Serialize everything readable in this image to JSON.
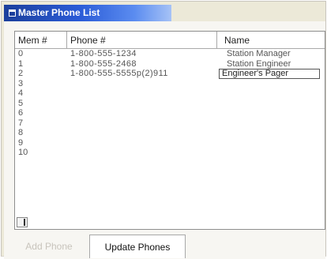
{
  "window": {
    "title": "Master Phone List"
  },
  "grid": {
    "columns": {
      "mem": "Mem #",
      "phone": "Phone #",
      "name": "Name"
    },
    "rows": [
      {
        "mem": "0",
        "phone": "1-800-555-1234",
        "name": "Station Manager"
      },
      {
        "mem": "1",
        "phone": "1-800-555-2468",
        "name": "Station Engineer"
      },
      {
        "mem": "2",
        "phone": "1-800-555-5555p(2)911",
        "name": "Engineer's Pager"
      },
      {
        "mem": "3",
        "phone": "",
        "name": ""
      },
      {
        "mem": "4",
        "phone": "",
        "name": ""
      },
      {
        "mem": "5",
        "phone": "",
        "name": ""
      },
      {
        "mem": "6",
        "phone": "",
        "name": ""
      },
      {
        "mem": "7",
        "phone": "",
        "name": ""
      },
      {
        "mem": "8",
        "phone": "",
        "name": ""
      },
      {
        "mem": "9",
        "phone": "",
        "name": ""
      },
      {
        "mem": "10",
        "phone": "",
        "name": ""
      }
    ],
    "editing_row": 2
  },
  "buttons": {
    "add_phone": "Add Phone",
    "update_phones": "Update Phones"
  },
  "colors": {
    "title_bar": "#2a5bd7",
    "disabled_text": "#c8c4bc"
  },
  "icons": {
    "title": "window-icon"
  }
}
